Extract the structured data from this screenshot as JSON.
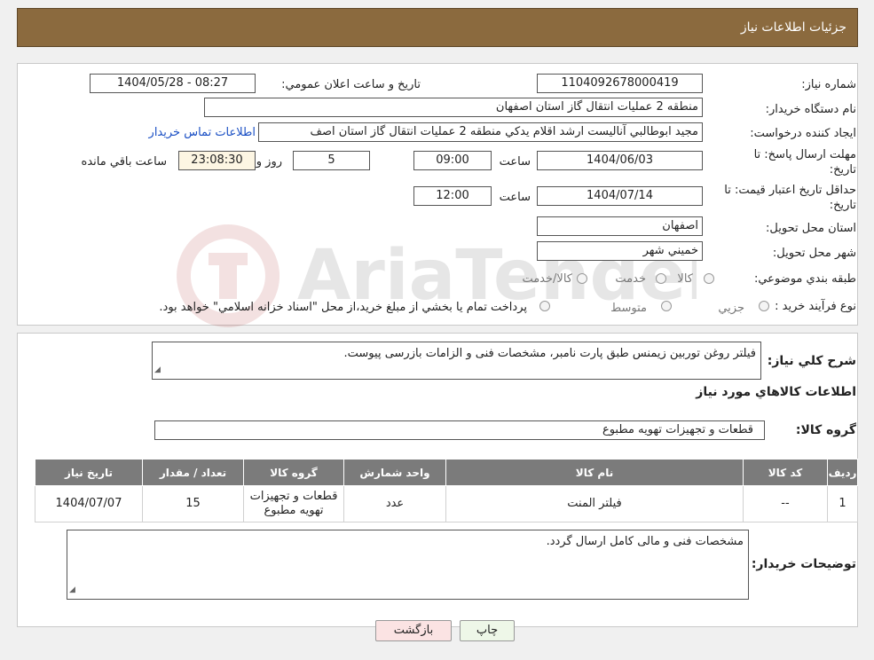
{
  "header": {
    "title": "جزئیات اطلاعات نیاز"
  },
  "form": {
    "need_number_label": "شماره نياز:",
    "need_number": "1104092678000419",
    "announce_label": "تاريخ و ساعت اعلان عمومي:",
    "announce_value": "1404/05/28 - 08:27",
    "buyer_org_label": "نام دستگاه خريدار:",
    "buyer_org": "منطقه 2 عمليات انتقال گاز استان اصفهان",
    "requester_label": "ايجاد كننده درخواست:",
    "requester": "مجيد ابوطالبي آناليست ارشد اقلام يدكي منطقه 2 عمليات انتقال گاز استان اصف",
    "contact_link": "اطلاعات تماس خريدار",
    "deadline_label_1": "مهلت ارسال پاسخ: تا",
    "deadline_label_2": "تاريخ:",
    "deadline_date": "1404/06/03",
    "time_label": "ساعت",
    "deadline_time": "09:00",
    "days_value": "5",
    "days_label": "روز و",
    "remaining_time": "23:08:30",
    "remaining_label": "ساعت باقي مانده",
    "validity_label_1": "حداقل تاريخ اعتبار قيمت: تا",
    "validity_label_2": "تاريخ:",
    "validity_date": "1404/07/14",
    "validity_time_label": "ساعت",
    "validity_time": "12:00",
    "province_label": "استان محل تحويل:",
    "province": "اصفهان",
    "city_label": "شهر محل تحويل:",
    "city": "خميني شهر",
    "category_label": "طبقه بندي موضوعي:",
    "category_options": [
      "كالا",
      "خدمت",
      "كالا/خدمت"
    ],
    "process_label": "نوع فرآيند خريد :",
    "process_options": [
      "جزيي",
      "متوسط"
    ],
    "process_note": "پرداخت تمام يا بخشي از مبلغ خريد،از محل \"اسناد خزانه اسلامي\" خواهد بود."
  },
  "description": {
    "label": "شرح كلي نياز:",
    "text": "فيلتر روغن توربين زيمنس طبق پارت نامبر، مشخصات فنی و الزامات بازرسی پیوست.",
    "goods_info_title": "اطلاعات كالاهاي مورد نياز",
    "group_label": "گروه كالا:",
    "group_value": "قطعات و تجهيزات تهويه مطبوع"
  },
  "table": {
    "headers": [
      "رديف",
      "كد كالا",
      "نام كالا",
      "واحد شمارش",
      "گروه كالا",
      "تعداد / مقدار",
      "تاريخ نياز"
    ],
    "rows": [
      [
        "1",
        "--",
        "فيلتر المنت",
        "عدد",
        "قطعات و تجهيزات تهويه مطبوع",
        "15",
        "1404/07/07"
      ]
    ]
  },
  "buyer_notes": {
    "label": "توضيحات خريدار:",
    "text": "مشخصات فنی و مالی کامل ارسال گردد."
  },
  "buttons": {
    "print": "چاپ",
    "back": "بازگشت"
  },
  "watermark": {
    "text": "AriaTender.neT"
  },
  "colors": {
    "header_bg": "#8b6a3e",
    "table_header_bg": "#7b7b7b",
    "back_button_bg": "#fbe3e3",
    "print_button_bg": "#eef7e8",
    "link": "#1a4fc4"
  }
}
